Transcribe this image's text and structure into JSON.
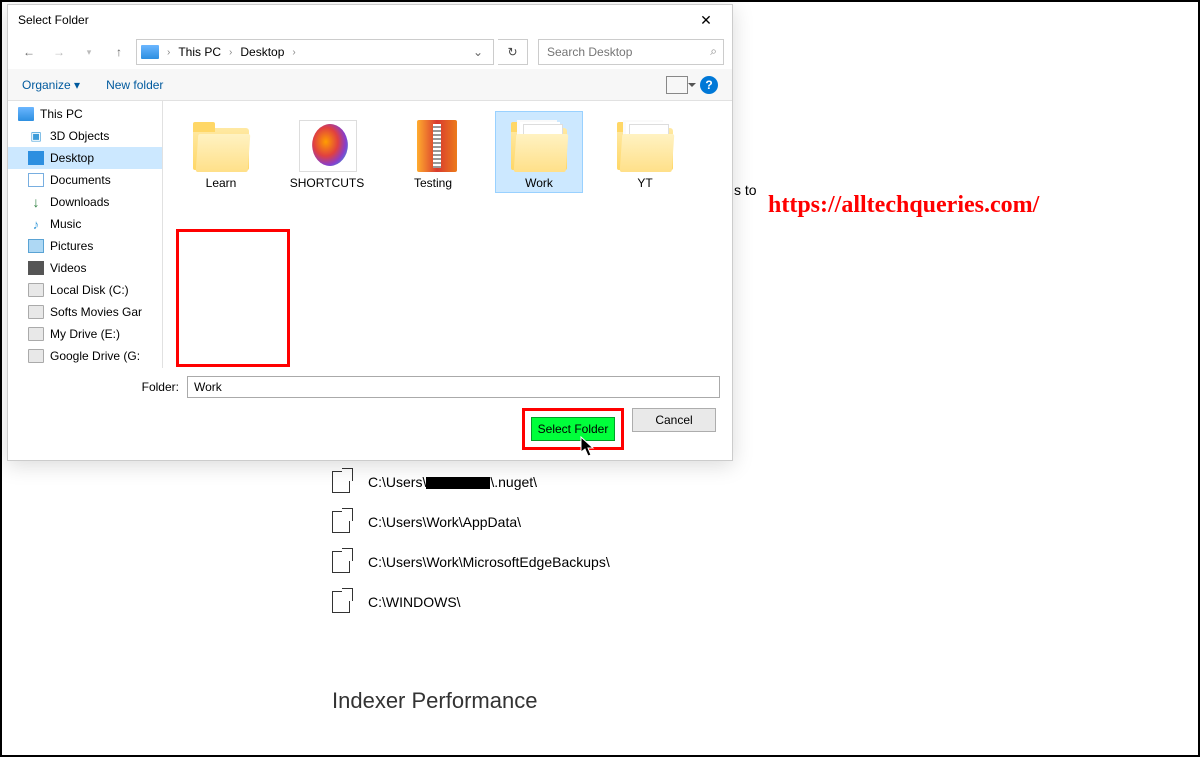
{
  "dialog": {
    "title": "Select Folder",
    "breadcrumb": {
      "pc": "This PC",
      "location": "Desktop"
    },
    "search_placeholder": "Search Desktop",
    "organize": "Organize",
    "new_folder": "New folder",
    "sidebar": [
      {
        "label": "This PC",
        "icon": "pc",
        "top": true
      },
      {
        "label": "3D Objects",
        "icon": "3d"
      },
      {
        "label": "Desktop",
        "icon": "desk",
        "selected": true
      },
      {
        "label": "Documents",
        "icon": "doc"
      },
      {
        "label": "Downloads",
        "icon": "down"
      },
      {
        "label": "Music",
        "icon": "music"
      },
      {
        "label": "Pictures",
        "icon": "pic"
      },
      {
        "label": "Videos",
        "icon": "vid"
      },
      {
        "label": "Local Disk (C:)",
        "icon": "disk"
      },
      {
        "label": "Softs Movies Gar",
        "icon": "disk"
      },
      {
        "label": "My Drive (E:)",
        "icon": "disk"
      },
      {
        "label": "Google Drive (G:",
        "icon": "disk"
      }
    ],
    "files": [
      {
        "label": "Learn",
        "type": "folder-img"
      },
      {
        "label": "SHORTCUTS",
        "type": "shortcut"
      },
      {
        "label": "Testing",
        "type": "zip"
      },
      {
        "label": "Work",
        "type": "folder-pages",
        "selected": true
      },
      {
        "label": "YT",
        "type": "folder-pages"
      }
    ],
    "folder_label": "Folder:",
    "folder_value": "Work",
    "select_btn": "Select Folder",
    "cancel_btn": "Cancel"
  },
  "background": {
    "clip": "s to",
    "paths": [
      {
        "pre": "C:\\Users\\",
        "redacted": true,
        "post": "\\.nuget\\"
      },
      {
        "text": "C:\\Users\\Work\\AppData\\"
      },
      {
        "text": "C:\\Users\\Work\\MicrosoftEdgeBackups\\"
      },
      {
        "text": "C:\\WINDOWS\\"
      }
    ],
    "section": "Indexer Performance"
  },
  "watermark": "https://alltechqueries.com/"
}
